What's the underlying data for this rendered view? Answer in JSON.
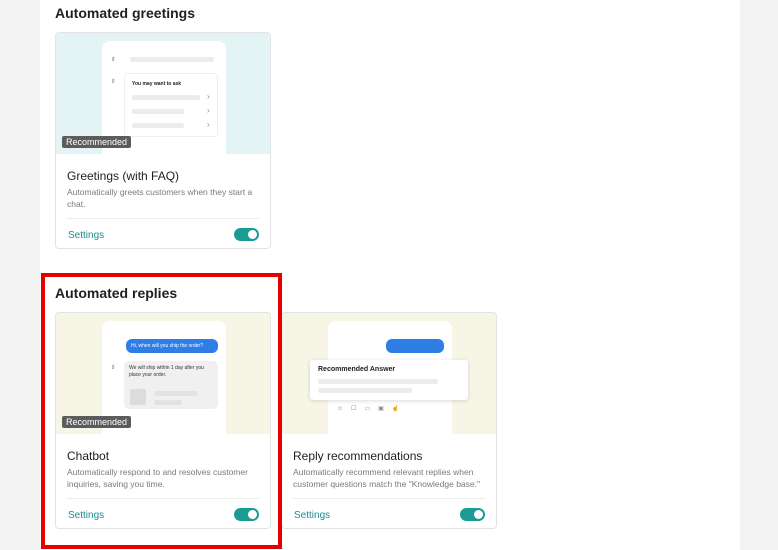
{
  "sections": {
    "greetings": {
      "title": "Automated greetings",
      "cards": [
        {
          "title": "Greetings (with FAQ)",
          "description": "Automatically greets customers when they start a chat.",
          "badge": "Recommended",
          "settings_label": "Settings",
          "enabled": true,
          "preview": {
            "ask_text": "You may want to ask"
          }
        }
      ]
    },
    "replies": {
      "title": "Automated replies",
      "cards": [
        {
          "title": "Chatbot",
          "description": "Automatically respond to and resolves customer inquiries, saving you time.",
          "badge": "Recommended",
          "settings_label": "Settings",
          "enabled": true,
          "preview": {
            "customer_message": "Hi, when will you ship the order?",
            "bot_message": "We will ship within 1 day after you place your order."
          }
        },
        {
          "title": "Reply recommendations",
          "description": "Automatically recommend relevant replies when customer questions match the \"Knowledge base.\"",
          "settings_label": "Settings",
          "enabled": true,
          "preview": {
            "recommended_answer": "Recommended Answer"
          }
        }
      ]
    }
  },
  "colors": {
    "accent": "#1a9c94",
    "link": "#1a8f8f",
    "highlight": "#e50000",
    "bubble": "#2f7ee6"
  }
}
